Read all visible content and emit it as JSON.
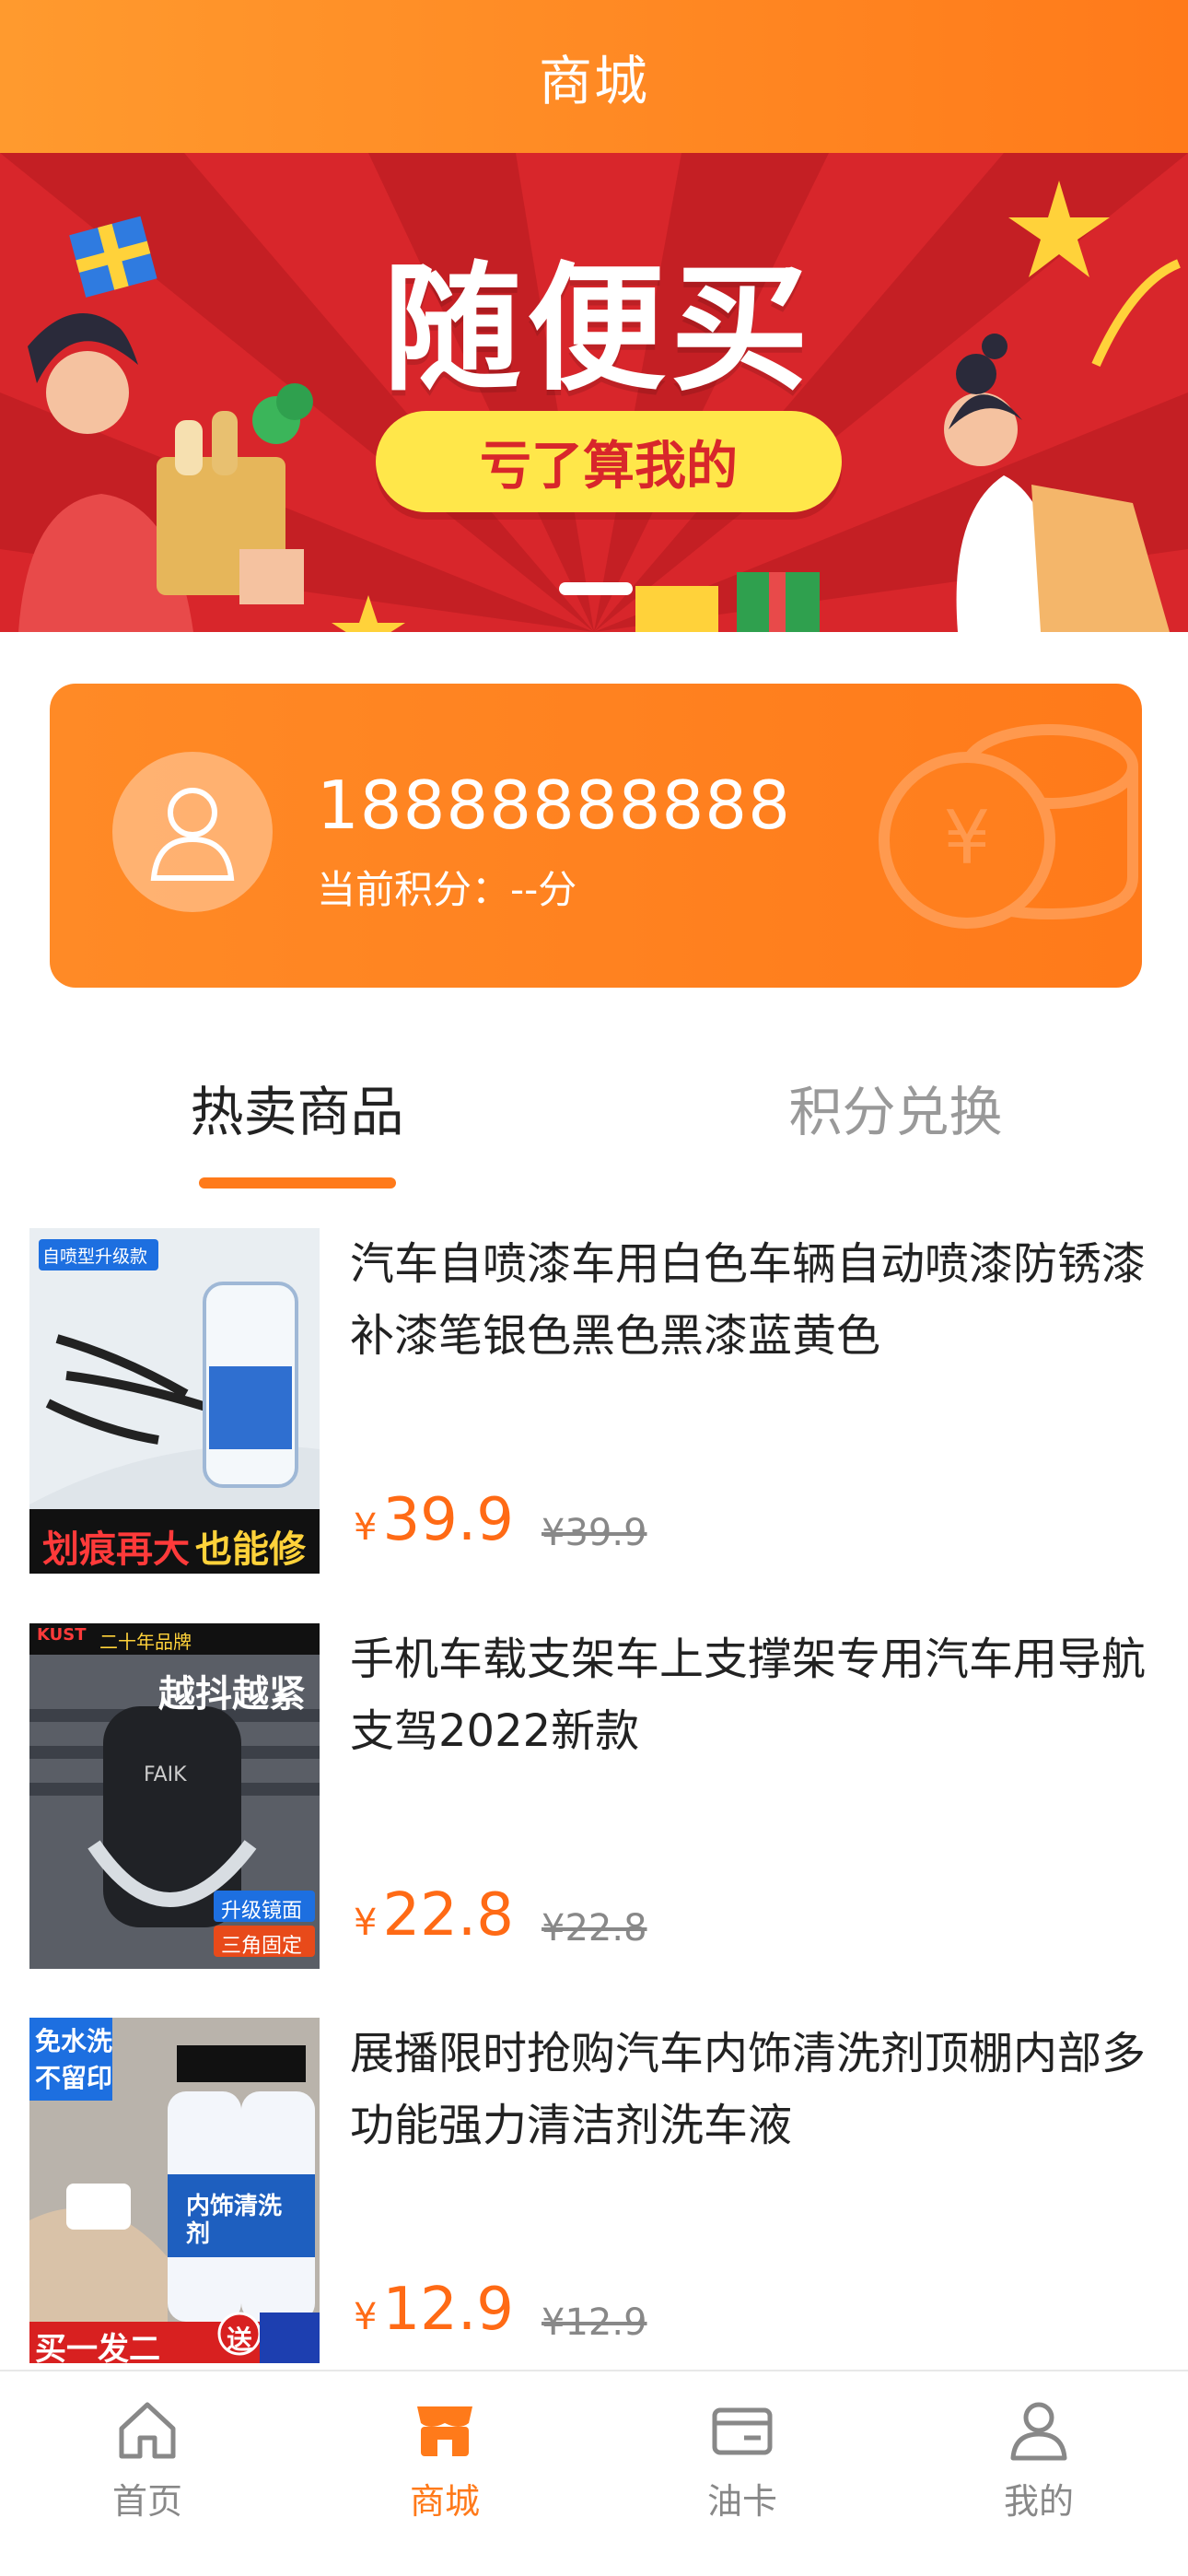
{
  "header": {
    "title": "商城"
  },
  "banner": {
    "headline": "随便买",
    "slogan": "亏了算我的"
  },
  "account": {
    "phone": "18888888888",
    "points_text": "当前积分：--分"
  },
  "tabs": [
    {
      "label": "热卖商品"
    },
    {
      "label": "积分兑换"
    }
  ],
  "products": [
    {
      "name": "汽车自喷漆车用白色车辆自动喷漆防锈漆补漆笔银色黑色黑漆蓝黄色",
      "price": "39.9",
      "original_price": "¥39.9",
      "thumb_badge_top": "自喷型升级款",
      "thumb_caption_left": "划痕再大",
      "thumb_caption_right": "也能修"
    },
    {
      "name": "手机车载支架车上支撑架专用汽车用导航支驾2022新款",
      "price": "22.8",
      "original_price": "¥22.8",
      "thumb_badge_brand": "KUST",
      "thumb_badge_years": "二十年品牌",
      "thumb_caption_top": "越抖越紧",
      "thumb_logo": "FAIK",
      "thumb_tag_1": "升级镜面",
      "thumb_tag_2": "三角固定"
    },
    {
      "name": "展播限时抢购汽车内饰清洗剂顶棚内部多功能强力清洁剂洗车液",
      "price": "12.9",
      "original_price": "¥12.9",
      "thumb_badge_1": "免水洗",
      "thumb_badge_2": "不留印",
      "thumb_bottle_text": "内饰清洗剂",
      "thumb_caption": "买一发二",
      "thumb_gift": "送"
    }
  ],
  "currency_symbol": "¥",
  "nav": [
    {
      "label": "首页",
      "icon": "home-icon"
    },
    {
      "label": "商城",
      "icon": "store-icon"
    },
    {
      "label": "油卡",
      "icon": "card-icon"
    },
    {
      "label": "我的",
      "icon": "user-icon"
    }
  ],
  "colors": {
    "brand_orange": "#ff7a1a",
    "banner_red": "#d8262b",
    "pill_yellow": "#ffe74a"
  }
}
